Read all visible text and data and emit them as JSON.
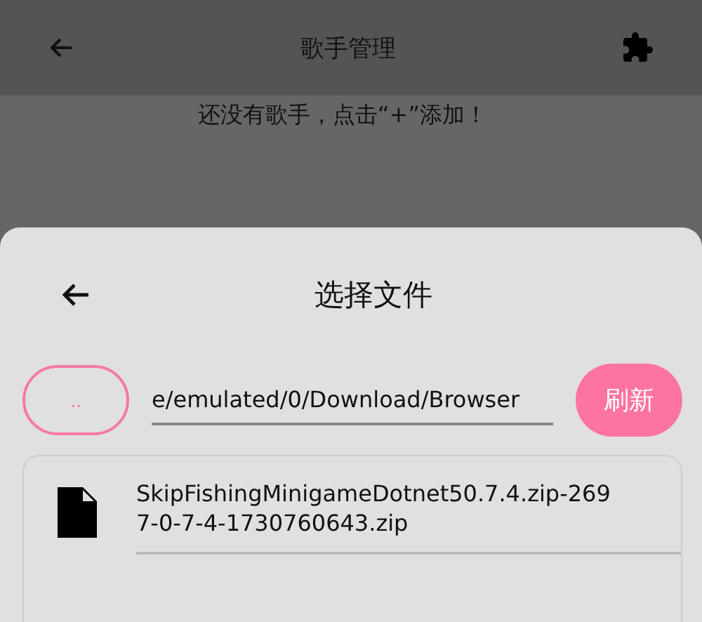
{
  "app_bar": {
    "title": "歌手管理"
  },
  "empty_message": "还没有歌手，点击“+”添加！",
  "dialog": {
    "title": "选择文件",
    "up_button": "..",
    "path": "e/emulated/0/Download/Browser",
    "refresh_button": "刷新",
    "files": [
      {
        "name": "SkipFishingMinigameDotnet50.7.4.zip-2697-0-7-4-1730760643.zip",
        "kind": "file"
      }
    ]
  }
}
